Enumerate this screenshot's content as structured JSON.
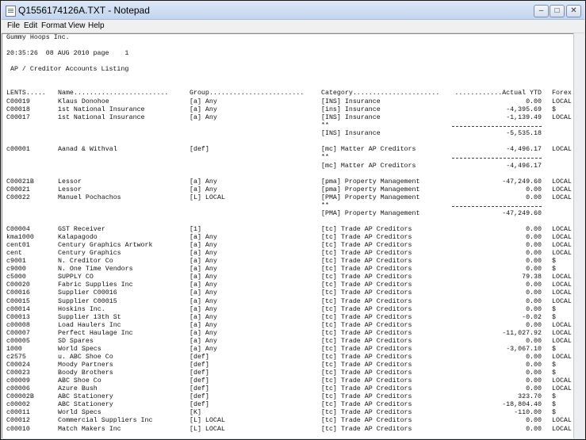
{
  "window": {
    "title": "Q1556174126A.TXT - Notepad",
    "min_label": "–",
    "max_label": "□",
    "close_label": "✕"
  },
  "menu": [
    "File",
    "Edit",
    "Format",
    "View",
    "Help"
  ],
  "report": {
    "company": "Gummy Hoops Inc.",
    "timestamp": "20:35:26  08 AUG 2010 page    1",
    "title": " AP / Creditor Accounts Listing",
    "headers": [
      "LENTS.....",
      "Name........................",
      "Group........................",
      "Category......................",
      "............Actual YTD",
      "Forex.."
    ],
    "rows": [
      [
        "C00019",
        "Klaus Donohoe",
        "[a] Any",
        "[INS] Insurance",
        "0.00",
        "LOCAL $"
      ],
      [
        "C00018",
        "1st National Insurance",
        "[a] Any",
        "[ins] Insurance",
        "-4,395.69",
        "$"
      ],
      [
        "C00017",
        "1st National Insurance",
        "[a] Any",
        "[INS] Insurance",
        "-1,139.49",
        "LOCAL $"
      ],
      [
        "",
        "",
        "",
        "**",
        "",
        ""
      ],
      [
        "",
        "",
        "",
        "[INS] Insurance",
        "-5,535.18",
        ""
      ],
      [
        "",
        "",
        "",
        "",
        "",
        ""
      ],
      [
        "c00001",
        "Aanad & Withval",
        "[def]",
        "[mc] Matter AP Creditors",
        "-4,496.17",
        "LOCAL $"
      ],
      [
        "",
        "",
        "",
        "**",
        "",
        ""
      ],
      [
        "",
        "",
        "",
        "[mc] Matter AP Creditors",
        "-4,496.17",
        ""
      ],
      [
        "",
        "",
        "",
        "",
        "",
        ""
      ],
      [
        "C00021B",
        "Lessor",
        "[a] Any",
        "[pma] Property Management",
        "-47,249.60",
        "LOCAL $"
      ],
      [
        "C00021",
        "Lessor",
        "[a] Any",
        "[pma] Property Management",
        "0.00",
        "LOCAL $"
      ],
      [
        "C00022",
        "Manuel Pochachos",
        "[L] LOCAL",
        "[PMA] Property Management",
        "0.00",
        "LOCAL $"
      ],
      [
        "",
        "",
        "",
        "**",
        "",
        ""
      ],
      [
        "",
        "",
        "",
        "[PMA] Property Management",
        "-47,249.60",
        ""
      ],
      [
        "",
        "",
        "",
        "",
        "",
        ""
      ],
      [
        "C00004",
        "GST Receiver",
        "[1]",
        "[tc] Trade AP Creditors",
        "0.00",
        "LOCAL $"
      ],
      [
        "kma1000",
        "Kalapagodo",
        "[a] Any",
        "[tc] Trade AP Creditors",
        "0.00",
        "LOCAL $"
      ],
      [
        "cent01",
        "Century Graphics Artwork",
        "[a] Any",
        "[tc] Trade AP Creditors",
        "0.00",
        "LOCAL $"
      ],
      [
        "cent",
        "Century Graphics",
        "[a] Any",
        "[tc] Trade AP Creditors",
        "0.00",
        "LOCAL $"
      ],
      [
        "c9001",
        "N. Creditor Co",
        "[a] Any",
        "[tc] Trade AP Creditors",
        "0.00",
        "$"
      ],
      [
        "c9000",
        "N. One Time Vendors",
        "[a] Any",
        "[tc] Trade AP Creditors",
        "0.00",
        "$"
      ],
      [
        "c5000",
        "SUPPLY CO",
        "[a] Any",
        "[tc] Trade AP Creditors",
        "79.38",
        "LOCAL $"
      ],
      [
        "C00020",
        "Fabric Supplies Inc",
        "[a] Any",
        "[tc] Trade AP Creditors",
        "0.00",
        "LOCAL $"
      ],
      [
        "C00016",
        "Supplier C00016",
        "[a] Any",
        "[tc] Trade AP Creditors",
        "0.00",
        "LOCAL $"
      ],
      [
        "C00015",
        "Supplier C00015",
        "[a] Any",
        "[tc] Trade AP Creditors",
        "0.00",
        "LOCAL $"
      ],
      [
        "c00014",
        "Hoskins Inc.",
        "[a] Any",
        "[tc] Trade AP Creditors",
        "0.00",
        "$"
      ],
      [
        "C00013",
        "Supplier 13th St",
        "[a] Any",
        "[tc] Trade AP Creditors",
        "-0.02",
        "$"
      ],
      [
        "c00008",
        "Load Haulers Inc",
        "[a] Any",
        "[tc] Trade AP Creditors",
        "0.00",
        "LOCAL $"
      ],
      [
        "C00007",
        "Perfect Haulage Inc",
        "[a] Any",
        "[tc] Trade AP Creditors",
        "-11,027.92",
        "LOCAL $"
      ],
      [
        "c00005",
        "SD Spares",
        "[a] Any",
        "[tc] Trade AP Creditors",
        "0.00",
        "LOCAL $"
      ],
      [
        "1000",
        "World Specs",
        "[a] Any",
        "[tc] Trade AP Creditors",
        "-3,067.10",
        "$"
      ],
      [
        "c2575",
        "u. ABC Shoe Co",
        "[def]",
        "[tc] Trade AP Creditors",
        "0.00",
        "LOCAL $"
      ],
      [
        "C00024",
        "Moody Partners",
        "[def]",
        "[tc] Trade AP Creditors",
        "0.00",
        "$"
      ],
      [
        "C00023",
        "Boody Brothers",
        "[def]",
        "[tc] Trade AP Creditors",
        "0.00",
        "$"
      ],
      [
        "c00009",
        "ABC Shoe Co",
        "[def]",
        "[tc] Trade AP Creditors",
        "0.00",
        "LOCAL $"
      ],
      [
        "c00006",
        "Azure Bush",
        "[def]",
        "[tc] Trade AP Creditors",
        "0.00",
        "LOCAL $"
      ],
      [
        "C00002B",
        "ABC Stationery",
        "[def]",
        "[tc] Trade AP Creditors",
        "323.70",
        "$"
      ],
      [
        "c00002",
        "ABC Stationery",
        "[def]",
        "[tc] Trade AP Creditors",
        "-18,804.40",
        "$"
      ],
      [
        "c00011",
        "World Specs",
        "[K]",
        "[tc] Trade AP Creditors",
        "-110.00",
        "$"
      ],
      [
        "C00012",
        "Commercial Suppliers Inc",
        "[L] LOCAL",
        "[tc] Trade AP Creditors",
        "0.00",
        "LOCAL $"
      ],
      [
        "c00010",
        "Match Makers Inc",
        "[L] LOCAL",
        "[tc] Trade AP Creditors",
        "0.00",
        "LOCAL $"
      ]
    ]
  }
}
